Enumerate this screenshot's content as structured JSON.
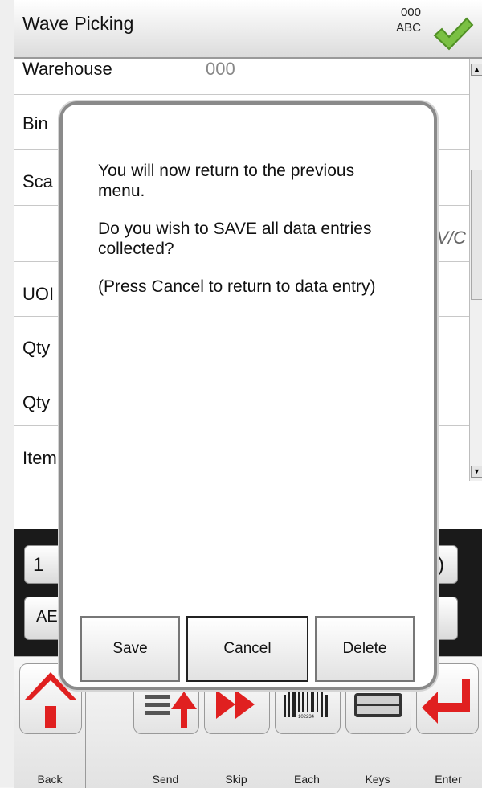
{
  "header": {
    "title": "Wave Picking",
    "code_line1": "000",
    "code_line2": "ABC",
    "confirm_icon": "checkmark-icon"
  },
  "form": {
    "rows": [
      {
        "label": "Warehouse",
        "value": "000"
      },
      {
        "label": "Bin",
        "value": ""
      },
      {
        "label": "Sca",
        "value": ""
      },
      {
        "label": "",
        "value": "",
        "partial": "V/C"
      },
      {
        "label": "UOI",
        "value": ""
      },
      {
        "label": "Qty",
        "value": ""
      },
      {
        "label": "Qty",
        "value": ""
      },
      {
        "label": "Item",
        "value": ""
      }
    ]
  },
  "keypad": {
    "key1": "1",
    "key_abc": "AE",
    "key_right_top": ")"
  },
  "toolbar": {
    "back": "Back",
    "send": "Send",
    "skip": "Skip",
    "each": "Each",
    "keys": "Keys",
    "enter": "Enter",
    "barcode_number": "102234"
  },
  "dialog": {
    "line1": "You will now return to the previous menu.",
    "line2": "Do you wish to SAVE all data entries collected?",
    "line3": "(Press Cancel to return to data entry)",
    "save": "Save",
    "cancel": "Cancel",
    "delete": "Delete"
  },
  "colors": {
    "keypad_bg": "#1a1a1a",
    "check_green": "#7ac043",
    "home_red": "#e02020",
    "arrow_red": "#e02020"
  }
}
